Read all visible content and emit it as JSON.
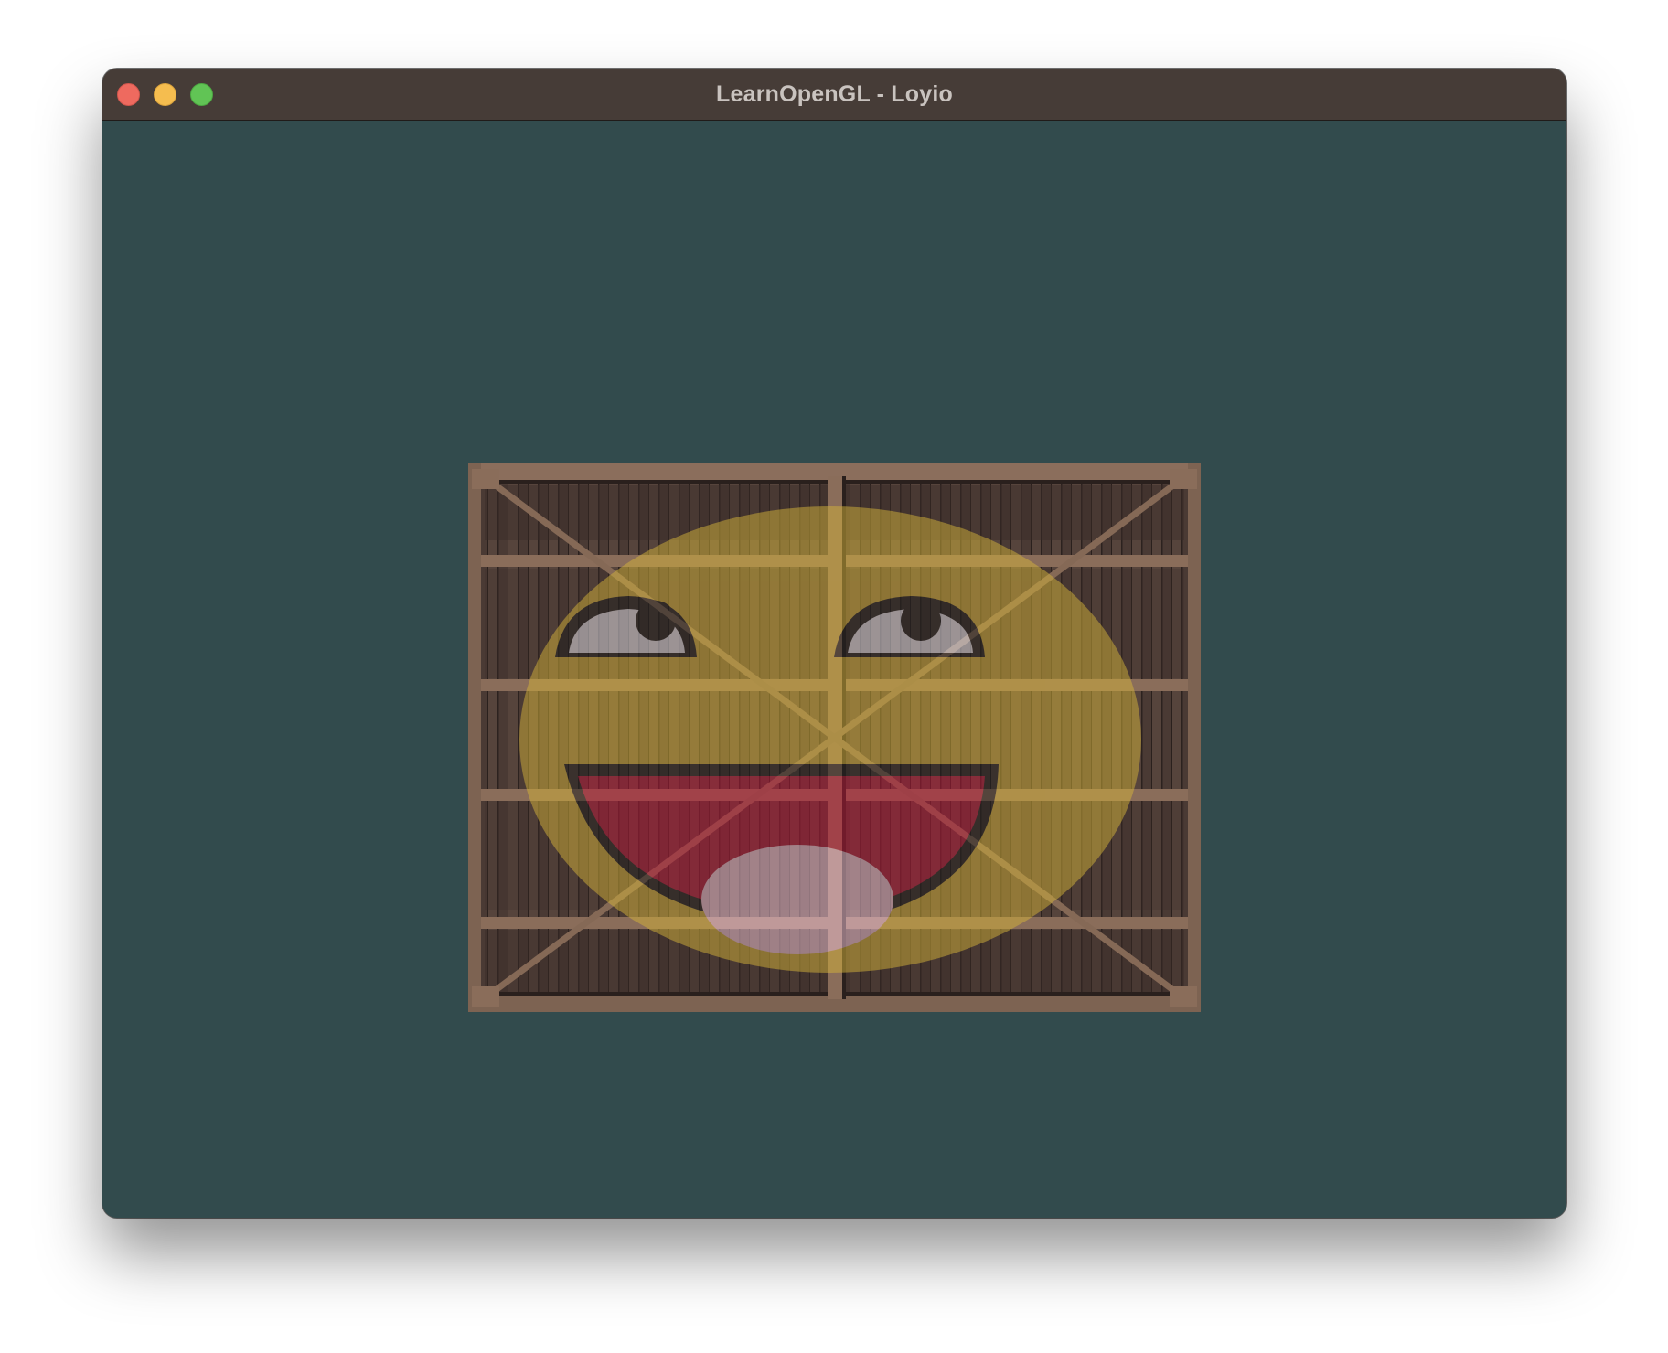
{
  "window": {
    "title": "LearnOpenGL - Loyio",
    "clear_color": "#324b4d",
    "titlebar_color": "#463c37"
  },
  "traffic_lights": {
    "close": {
      "icon": "close-circle-icon",
      "color": "#ee6a5f"
    },
    "minimize": {
      "icon": "minimize-circle-icon",
      "color": "#f5bd4f"
    },
    "maximize": {
      "icon": "maximize-circle-icon",
      "color": "#61c455"
    }
  },
  "render": {
    "textures": [
      "wooden-container-icon",
      "awesome-face-icon"
    ],
    "blend": "mix 0.2-ish overlay of face over container"
  }
}
